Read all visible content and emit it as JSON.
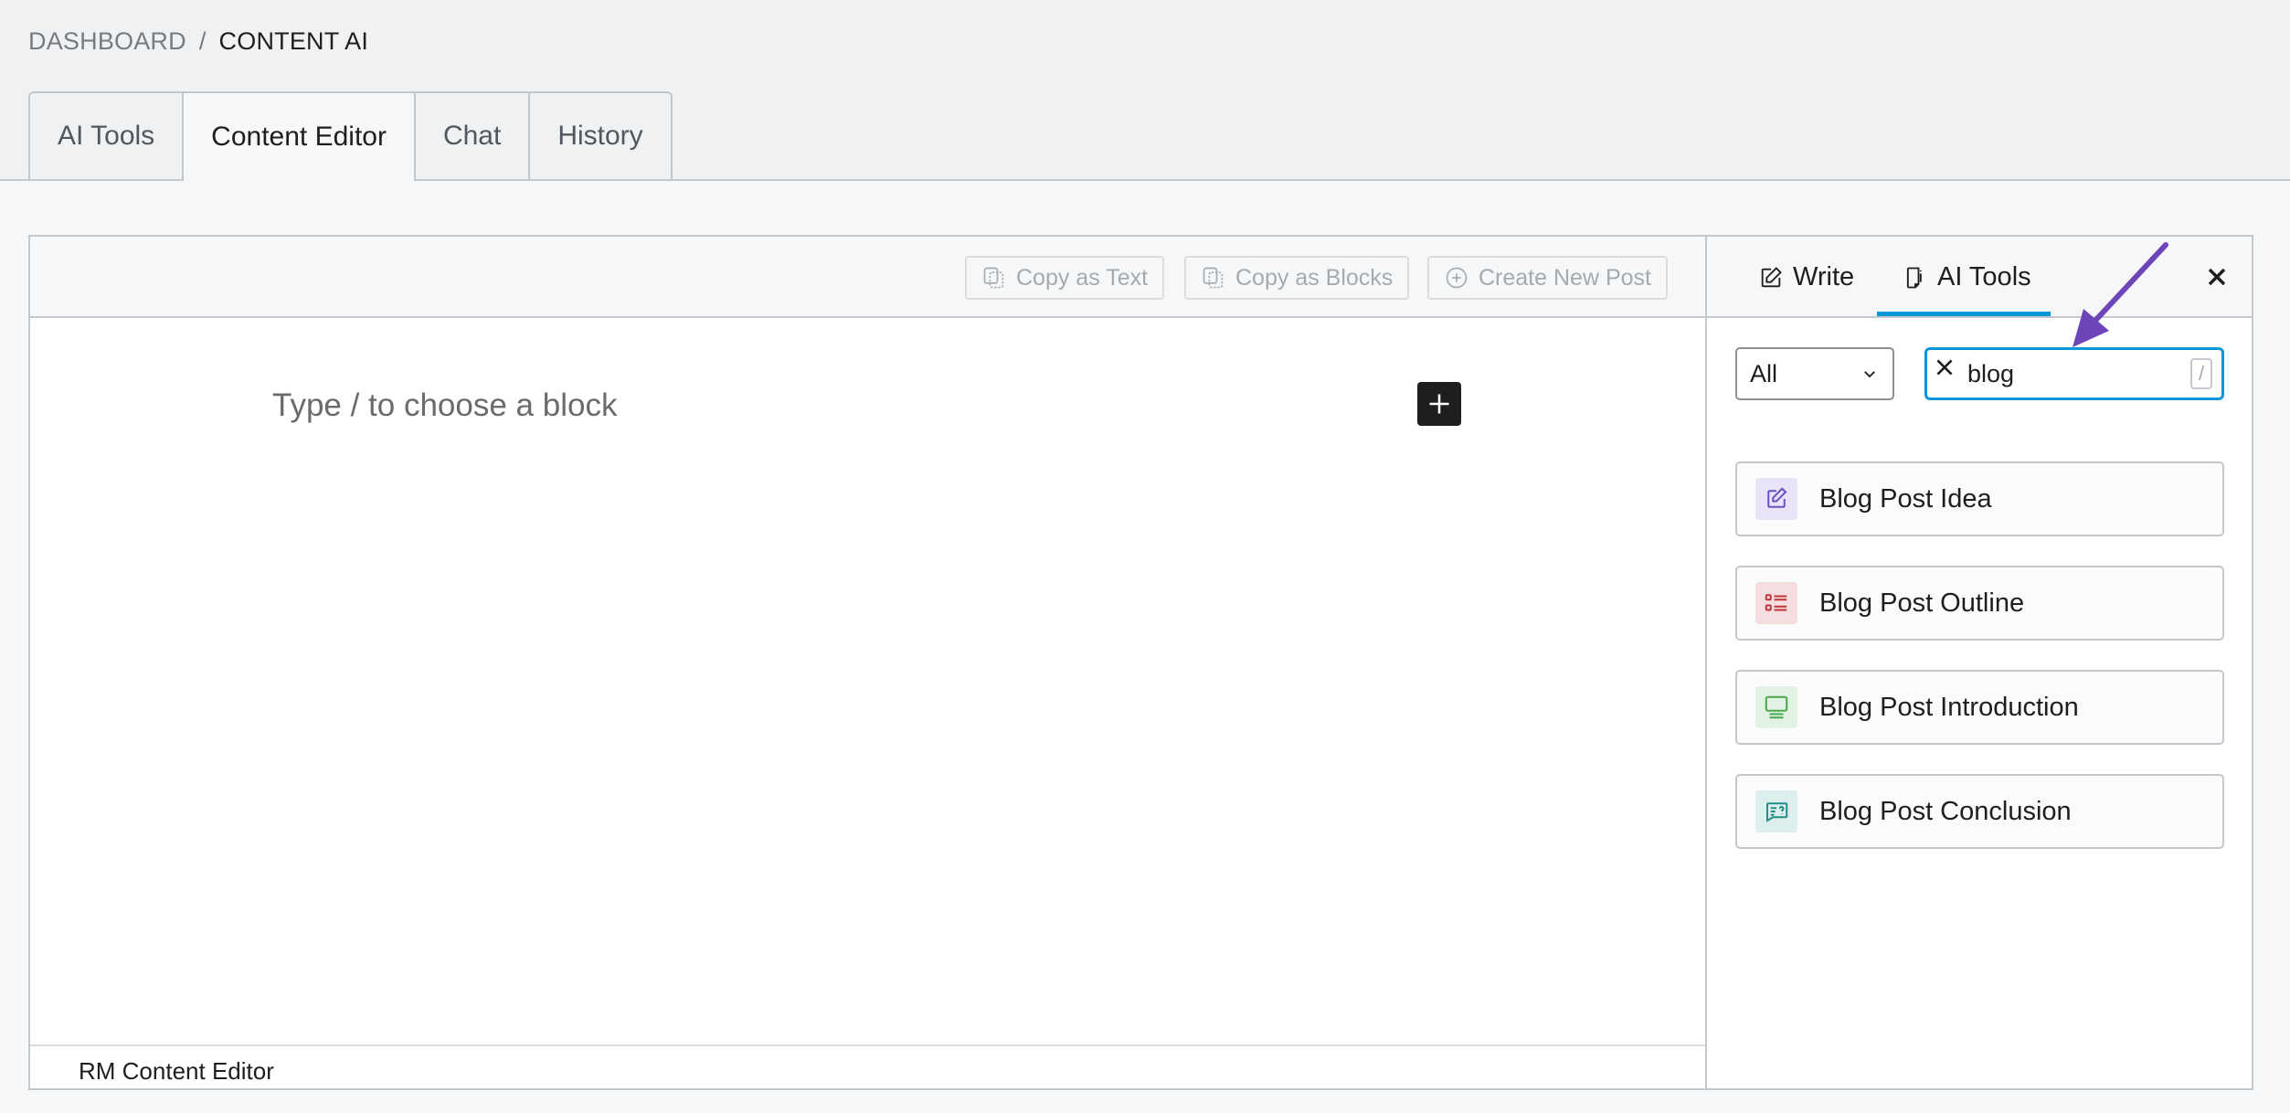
{
  "breadcrumb": {
    "parent": "DASHBOARD",
    "separator": "/",
    "current": "CONTENT AI"
  },
  "tabs": [
    {
      "label": "AI Tools",
      "active": false
    },
    {
      "label": "Content Editor",
      "active": true
    },
    {
      "label": "Chat",
      "active": false
    },
    {
      "label": "History",
      "active": false
    }
  ],
  "toolbar": {
    "copy_text_label": "Copy as Text",
    "copy_blocks_label": "Copy as Blocks",
    "create_post_label": "Create New Post"
  },
  "editor": {
    "placeholder": "Type / to choose a block",
    "footer_label": "RM Content Editor"
  },
  "sidebar": {
    "tabs": [
      {
        "label": "Write",
        "icon": "edit-icon",
        "active": false
      },
      {
        "label": "AI Tools",
        "icon": "ai-tools-icon",
        "active": true
      }
    ],
    "filter": {
      "selected": "All"
    },
    "search": {
      "value": "blog",
      "shortcut": "/"
    },
    "results": [
      {
        "label": "Blog Post Idea",
        "icon": "edit-icon",
        "color": "#6a4fbf",
        "bg": "#e9e3f7"
      },
      {
        "label": "Blog Post Outline",
        "icon": "list-icon",
        "color": "#c0343b",
        "bg": "#f5dedf"
      },
      {
        "label": "Blog Post Introduction",
        "icon": "monitor-icon",
        "color": "#4aa84a",
        "bg": "#e2f2e2"
      },
      {
        "label": "Blog Post Conclusion",
        "icon": "chat-question-icon",
        "color": "#1f8f86",
        "bg": "#dcefed"
      }
    ]
  },
  "colors": {
    "accent": "#0a97d9",
    "annotation_arrow": "#6d45b8"
  }
}
